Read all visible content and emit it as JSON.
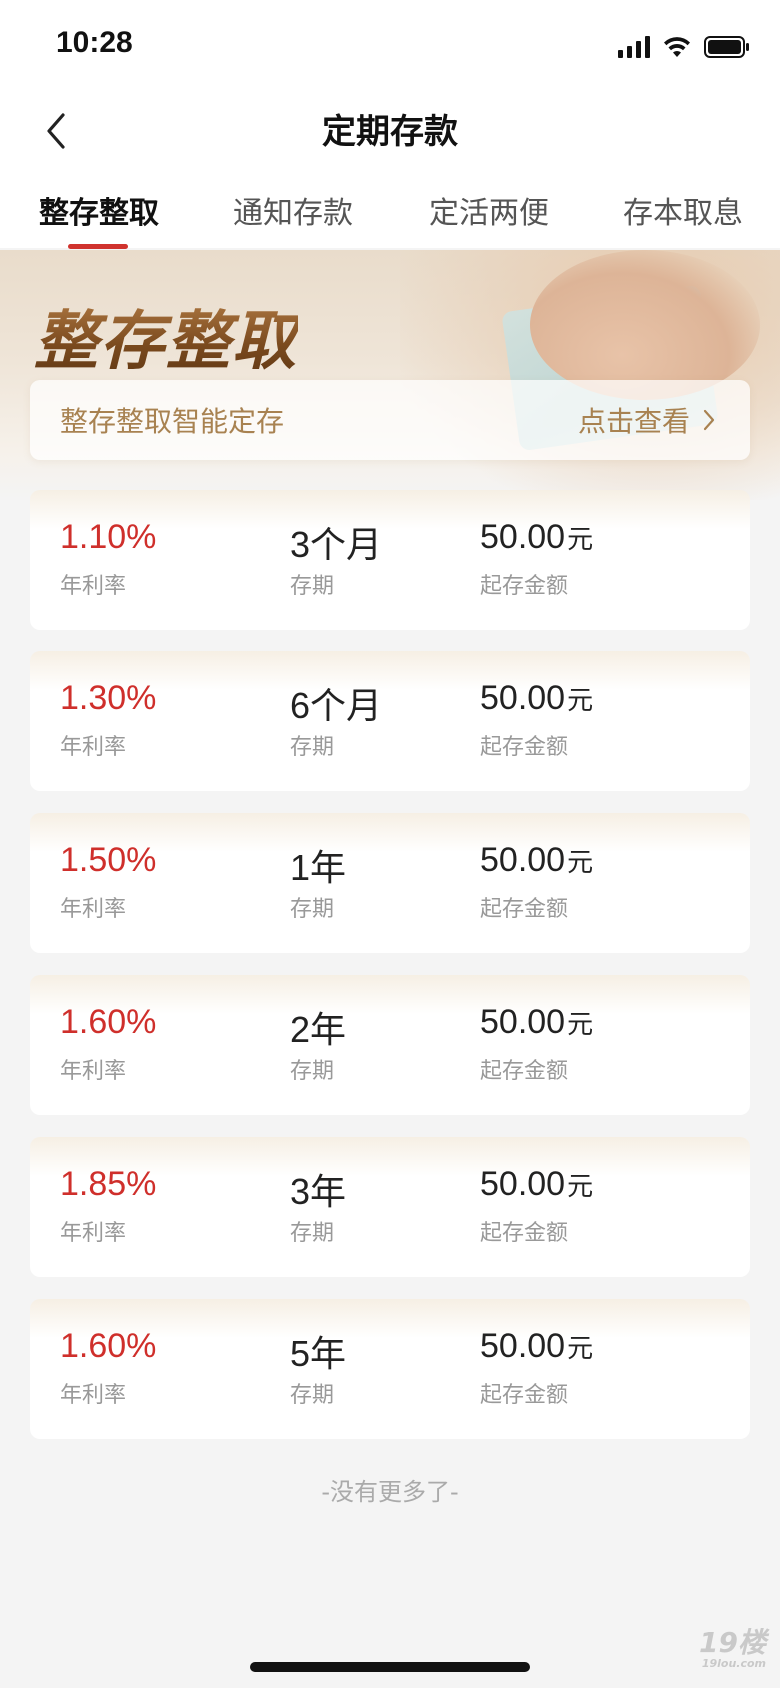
{
  "status_bar": {
    "time": "10:28"
  },
  "nav": {
    "title": "定期存款"
  },
  "tabs": [
    {
      "label": "整存整取"
    },
    {
      "label": "通知存款"
    },
    {
      "label": "定活两便"
    },
    {
      "label": "存本取息"
    }
  ],
  "banner": {
    "title": "整存整取",
    "smart_label": "整存整取智能定存",
    "smart_link": "点击查看"
  },
  "products": [
    {
      "rate": "1.10%",
      "rate_label": "年利率",
      "term": "3个月",
      "term_label": "存期",
      "amount": "50.00",
      "amount_unit": "元",
      "amount_label": "起存金额"
    },
    {
      "rate": "1.30%",
      "rate_label": "年利率",
      "term": "6个月",
      "term_label": "存期",
      "amount": "50.00",
      "amount_unit": "元",
      "amount_label": "起存金额"
    },
    {
      "rate": "1.50%",
      "rate_label": "年利率",
      "term": "1年",
      "term_label": "存期",
      "amount": "50.00",
      "amount_unit": "元",
      "amount_label": "起存金额"
    },
    {
      "rate": "1.60%",
      "rate_label": "年利率",
      "term": "2年",
      "term_label": "存期",
      "amount": "50.00",
      "amount_unit": "元",
      "amount_label": "起存金额"
    },
    {
      "rate": "1.85%",
      "rate_label": "年利率",
      "term": "3年",
      "term_label": "存期",
      "amount": "50.00",
      "amount_unit": "元",
      "amount_label": "起存金额"
    },
    {
      "rate": "1.60%",
      "rate_label": "年利率",
      "term": "5年",
      "term_label": "存期",
      "amount": "50.00",
      "amount_unit": "元",
      "amount_label": "起存金额"
    }
  ],
  "footer": {
    "no_more": "-没有更多了-"
  },
  "watermark": {
    "main": "19楼",
    "sub": "19lou.com"
  },
  "colors": {
    "accent_red": "#cf2f2b",
    "gold": "#a88251",
    "tab_underline": "#d0332e"
  },
  "icons": {
    "back": "chevron-left-icon",
    "smart_link": "chevron-right-icon",
    "signal": "signal-icon",
    "wifi": "wifi-icon",
    "battery": "battery-icon"
  }
}
